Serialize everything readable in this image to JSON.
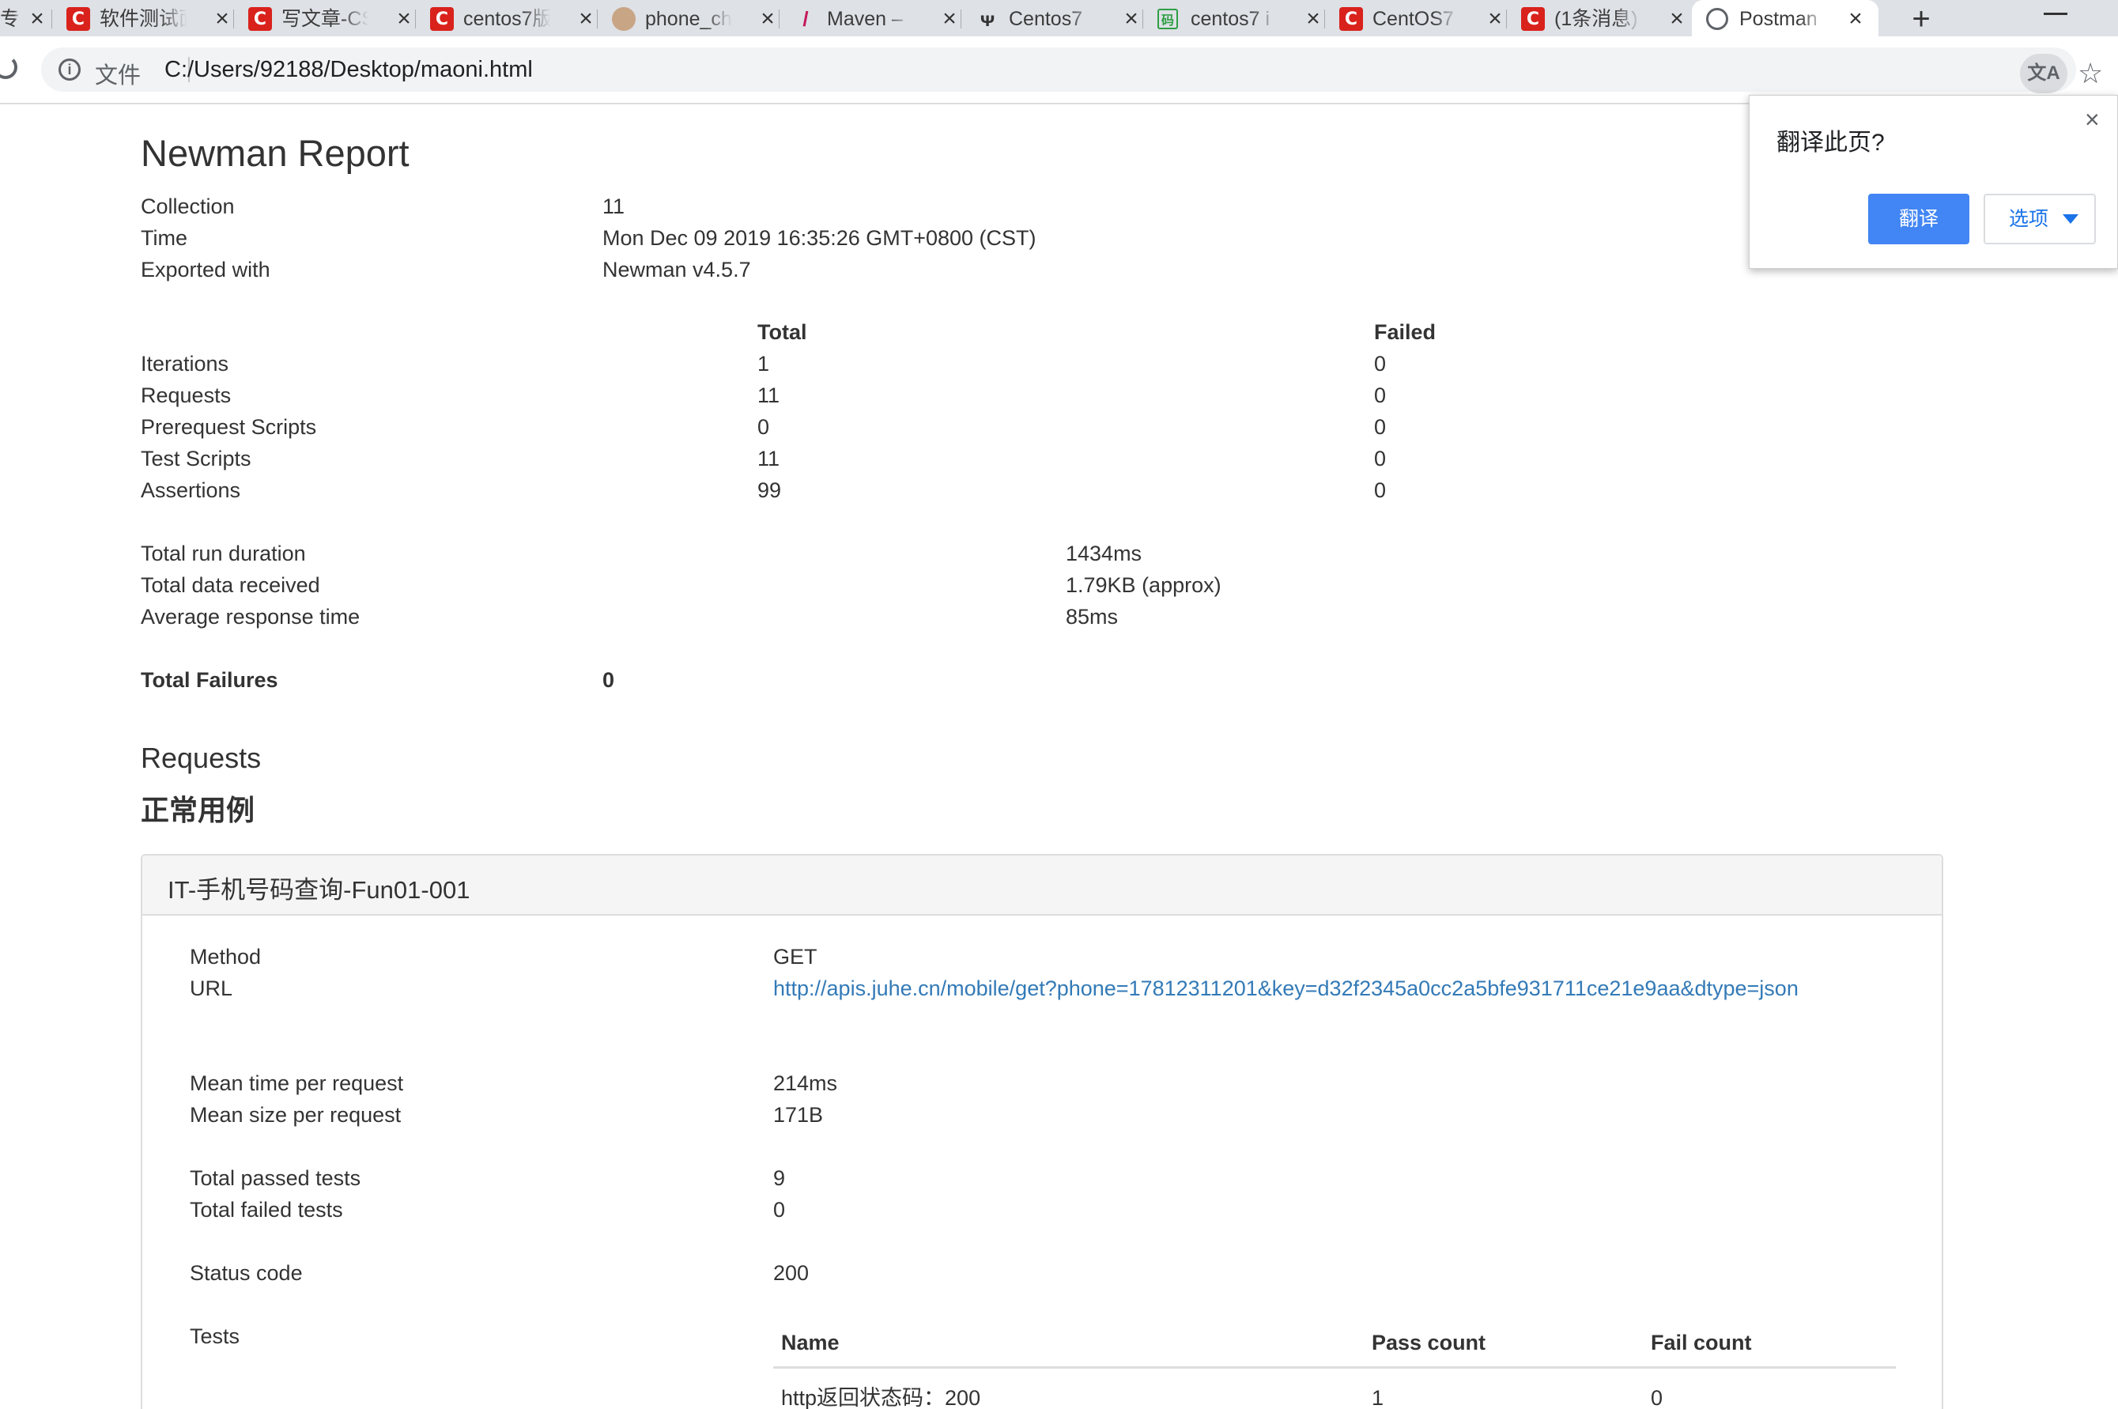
{
  "browser": {
    "tabs": [
      {
        "title": "专",
        "icon": "generic-icon"
      },
      {
        "title": "软件测试面",
        "icon": "csdn-icon"
      },
      {
        "title": "写文章-CS",
        "icon": "csdn-icon"
      },
      {
        "title": "centos7版",
        "icon": "csdn-icon"
      },
      {
        "title": "phone_ch",
        "icon": "avatar-icon"
      },
      {
        "title": "Maven –",
        "icon": "feather-icon"
      },
      {
        "title": "Centos7",
        "icon": "antelope-icon"
      },
      {
        "title": "centos7 i",
        "icon": "code-icon"
      },
      {
        "title": "CentOS7",
        "icon": "csdn-icon"
      },
      {
        "title": "(1条消息)",
        "icon": "csdn-icon"
      },
      {
        "title": "Postman",
        "icon": "globe-icon"
      }
    ],
    "address": {
      "label": "文件",
      "url": "C:/Users/92188/Desktop/maoni.html"
    }
  },
  "translate_popup": {
    "title": "翻译此页?",
    "translate_label": "翻译",
    "options_label": "选项"
  },
  "report": {
    "title": "Newman Report",
    "meta": [
      {
        "label": "Collection",
        "value": "11"
      },
      {
        "label": "Time",
        "value": "Mon Dec 09 2019 16:35:26 GMT+0800 (CST)"
      },
      {
        "label": "Exported with",
        "value": "Newman v4.5.7"
      }
    ],
    "stats_headers": {
      "total": "Total",
      "failed": "Failed"
    },
    "stats": [
      {
        "label": "Iterations",
        "total": "1",
        "failed": "0"
      },
      {
        "label": "Requests",
        "total": "11",
        "failed": "0"
      },
      {
        "label": "Prerequest Scripts",
        "total": "0",
        "failed": "0"
      },
      {
        "label": "Test Scripts",
        "total": "11",
        "failed": "0"
      },
      {
        "label": "Assertions",
        "total": "99",
        "failed": "0"
      }
    ],
    "timings": [
      {
        "label": "Total run duration",
        "value": "1434ms"
      },
      {
        "label": "Total data received",
        "value": "1.79KB (approx)"
      },
      {
        "label": "Average response time",
        "value": "85ms"
      }
    ],
    "total_failures": {
      "label": "Total Failures",
      "value": "0"
    },
    "requests_heading": "Requests",
    "folder_name": "正常用例",
    "request": {
      "name": "IT-手机号码查询-Fun01-001",
      "method_label": "Method",
      "method": "GET",
      "url_label": "URL",
      "url": "http://apis.juhe.cn/mobile/get?phone=17812311201&key=d32f2345a0cc2a5bfe931711ce21e9aa&dtype=json",
      "mean_time_label": "Mean time per request",
      "mean_time": "214ms",
      "mean_size_label": "Mean size per request",
      "mean_size": "171B",
      "passed_label": "Total passed tests",
      "passed": "9",
      "failed_label": "Total failed tests",
      "failed": "0",
      "status_label": "Status code",
      "status": "200",
      "tests_label": "Tests",
      "tests_headers": {
        "name": "Name",
        "pass": "Pass count",
        "fail": "Fail count"
      },
      "tests": [
        {
          "name": "http返回状态码：200",
          "pass": "1",
          "fail": "0"
        }
      ]
    }
  }
}
